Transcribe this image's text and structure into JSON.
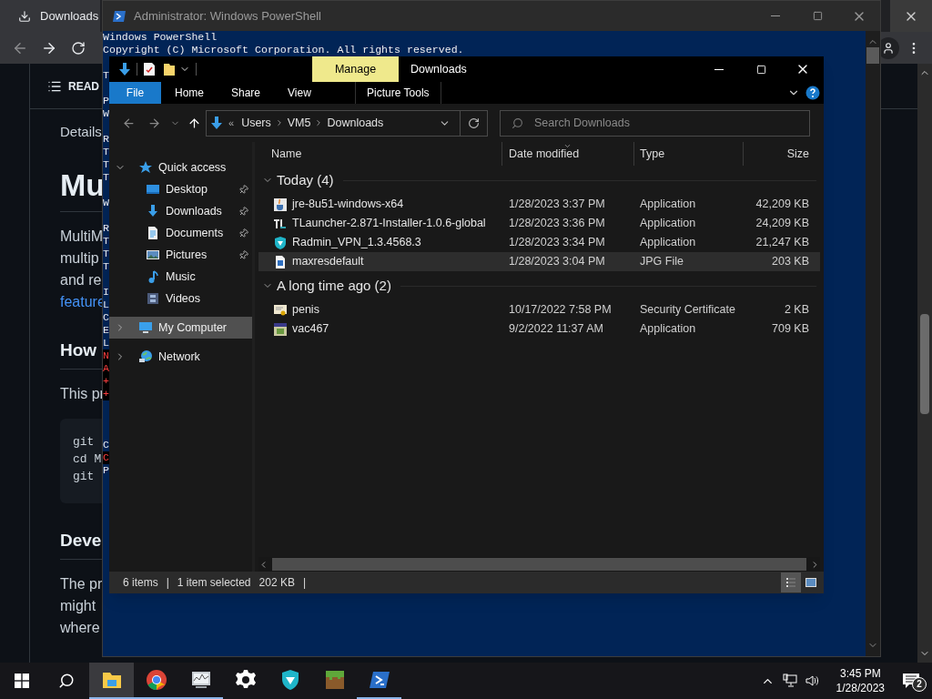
{
  "browser": {
    "tab": {
      "title": "Downloads"
    },
    "readme_header": "READ",
    "blocks": [
      {
        "kind": "label",
        "lines": [
          {
            "text": "Details",
            "link": false
          }
        ]
      },
      {
        "kind": "h1",
        "lines": [
          {
            "text": "Mu",
            "link": false
          }
        ]
      },
      {
        "kind": "p",
        "lines": [
          {
            "text": "MultiM",
            "link": false
          },
          {
            "text": "multip",
            "link": false
          },
          {
            "text": "and re",
            "link": false
          },
          {
            "text": "feature",
            "link": true
          }
        ]
      },
      {
        "kind": "h2",
        "lines": [
          {
            "text": "How",
            "link": false
          }
        ]
      },
      {
        "kind": "p",
        "lines": [
          {
            "text": "This pr",
            "link": false
          }
        ]
      },
      {
        "kind": "code",
        "lines": [
          {
            "text": "git",
            "link": false
          },
          {
            "text": "cd M",
            "link": false
          },
          {
            "text": "git",
            "link": false
          }
        ]
      },
      {
        "kind": "h2",
        "lines": [
          {
            "text": "Deve",
            "link": false
          }
        ]
      },
      {
        "kind": "p",
        "lines": [
          {
            "text": "The pr",
            "link": false
          },
          {
            "text": "might",
            "link": false
          },
          {
            "text": "where",
            "link": false
          }
        ]
      }
    ]
  },
  "powershell": {
    "title": "Administrator: Windows PowerShell",
    "lines": [
      {
        "kind": "output",
        "text": "Windows PowerShell"
      },
      {
        "kind": "output",
        "text": "Copyright (C) Microsoft Corporation. All rights reserved."
      },
      {
        "kind": "blank"
      },
      {
        "kind": "output",
        "text": "T"
      },
      {
        "kind": "blank"
      },
      {
        "kind": "output",
        "text": "P"
      },
      {
        "kind": "output",
        "text": "W"
      },
      {
        "kind": "blank"
      },
      {
        "kind": "output",
        "text": "R"
      },
      {
        "kind": "output",
        "text": "T"
      },
      {
        "kind": "output",
        "text": "T"
      },
      {
        "kind": "output",
        "text": "T"
      },
      {
        "kind": "blank"
      },
      {
        "kind": "output",
        "text": "W"
      },
      {
        "kind": "blank"
      },
      {
        "kind": "output",
        "text": "R"
      },
      {
        "kind": "output",
        "text": "T"
      },
      {
        "kind": "output",
        "text": "T"
      },
      {
        "kind": "output",
        "text": "T"
      },
      {
        "kind": "blank"
      },
      {
        "kind": "output",
        "text": "I"
      },
      {
        "kind": "output",
        "text": "L"
      },
      {
        "kind": "output",
        "text": "C"
      },
      {
        "kind": "output",
        "text": "E"
      },
      {
        "kind": "output",
        "text": "L"
      },
      {
        "kind": "error",
        "text": "N"
      },
      {
        "kind": "error",
        "text": "A"
      },
      {
        "kind": "error",
        "text": "+"
      },
      {
        "kind": "error",
        "text": "+"
      },
      {
        "kind": "error_blank"
      },
      {
        "kind": "error_blank"
      },
      {
        "kind": "blank"
      },
      {
        "kind": "output",
        "text": "C"
      },
      {
        "kind": "error",
        "text": "C"
      },
      {
        "kind": "output",
        "text": "P"
      }
    ]
  },
  "explorer": {
    "title": "Downloads",
    "contextual_tab": "Manage",
    "ribbon_tabs": [
      {
        "label": "File",
        "kind": "file"
      },
      {
        "label": "Home",
        "kind": "tab"
      },
      {
        "label": "Share",
        "kind": "tab"
      },
      {
        "label": "View",
        "kind": "tab"
      },
      {
        "label": "Picture Tools",
        "kind": "contextual"
      }
    ],
    "address": {
      "overflow_mark": "«",
      "segments": [
        "Users",
        "VM5",
        "Downloads"
      ]
    },
    "search": {
      "placeholder": "Search Downloads"
    },
    "nav": [
      {
        "label": "Quick access",
        "kind": "star",
        "expanded": true,
        "selected": false,
        "children": [
          {
            "label": "Desktop",
            "kind": "desktop",
            "pinned": true,
            "selected": false
          },
          {
            "label": "Downloads",
            "kind": "downloads",
            "pinned": true,
            "selected": false
          },
          {
            "label": "Documents",
            "kind": "documents",
            "pinned": true,
            "selected": false
          },
          {
            "label": "Pictures",
            "kind": "pictures",
            "pinned": true,
            "selected": false
          },
          {
            "label": "Music",
            "kind": "music",
            "pinned": false,
            "selected": false
          },
          {
            "label": "Videos",
            "kind": "videos",
            "pinned": false,
            "selected": false
          }
        ]
      },
      {
        "label": "My Computer",
        "kind": "computer",
        "expanded": false,
        "selected": true
      },
      {
        "label": "Network",
        "kind": "network",
        "expanded": false,
        "selected": false
      }
    ],
    "columns": [
      "Name",
      "Date modified",
      "Type",
      "Size"
    ],
    "groups": [
      {
        "label": "Today (4)",
        "expanded": true,
        "rows": [
          {
            "name": "jre-8u51-windows-x64",
            "date": "1/28/2023 3:37 PM",
            "type": "Application",
            "size": "42,209 KB",
            "kind": "java",
            "selected": false
          },
          {
            "name": "TLauncher-2.871-Installer-1.0.6-global",
            "date": "1/28/2023 3:36 PM",
            "type": "Application",
            "size": "24,209 KB",
            "kind": "launcher",
            "selected": false
          },
          {
            "name": "Radmin_VPN_1.3.4568.3",
            "date": "1/28/2023 3:34 PM",
            "type": "Application",
            "size": "21,247 KB",
            "kind": "vpn",
            "selected": false
          },
          {
            "name": "maxresdefault",
            "date": "1/28/2023 3:04 PM",
            "type": "JPG File",
            "size": "203 KB",
            "kind": "image",
            "selected": true
          }
        ]
      },
      {
        "label": "A long time ago (2)",
        "expanded": true,
        "rows": [
          {
            "name": "penis",
            "date": "10/17/2022 7:58 PM",
            "type": "Security Certificate",
            "size": "2 KB",
            "kind": "certificate",
            "selected": false
          },
          {
            "name": "vac467",
            "date": "9/2/2022 11:37 AM",
            "type": "Application",
            "size": "709 KB",
            "kind": "program",
            "selected": false
          }
        ]
      }
    ],
    "status_bar": [
      "6 items",
      "|",
      "1 item selected",
      "202 KB",
      "|"
    ],
    "views": [
      {
        "kind": "details",
        "selected": true
      },
      {
        "kind": "thumbnails",
        "selected": false
      }
    ]
  },
  "taskbar": {
    "apps": [
      {
        "kind": "explorer",
        "active": true,
        "running": true
      },
      {
        "kind": "chrome",
        "active": false,
        "running": true
      },
      {
        "kind": "monitor",
        "active": false,
        "running": true
      },
      {
        "kind": "settings",
        "active": false,
        "running": false
      },
      {
        "kind": "vpn",
        "active": false,
        "running": false
      },
      {
        "kind": "minecraft",
        "active": false,
        "running": false
      },
      {
        "kind": "powershell",
        "active": false,
        "running": true
      }
    ],
    "time": "3:45 PM",
    "date": "1/28/2023",
    "notifications": "2"
  }
}
